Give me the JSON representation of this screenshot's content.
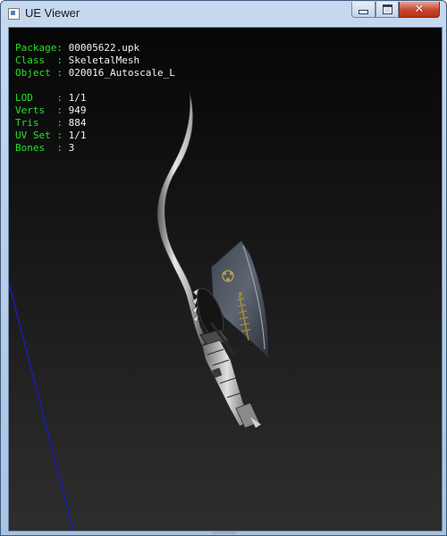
{
  "window": {
    "title": "UE Viewer",
    "controls": {
      "minimize": "minimize",
      "maximize": "maximize",
      "close": "✕"
    }
  },
  "mesh_info": {
    "package": {
      "label": "Package",
      "value": "00005622.upk"
    },
    "class": {
      "label": "Class",
      "value": "SkeletalMesh"
    },
    "object": {
      "label": "Object",
      "value": "020016_Autoscale_L"
    },
    "lod": {
      "label": "LOD",
      "value": "1/1"
    },
    "verts": {
      "label": "Verts",
      "value": "949"
    },
    "tris": {
      "label": "Tris",
      "value": "884"
    },
    "uv_set": {
      "label": "UV Set",
      "value": "1/1"
    },
    "bones": {
      "label": "Bones",
      "value": "3"
    }
  },
  "colors": {
    "label_green": "#27e227",
    "value_white": "#f2f2f2",
    "axis_blue": "#1a1ab8",
    "viewport_top": "#060606",
    "viewport_bottom": "#2e2e2e"
  }
}
